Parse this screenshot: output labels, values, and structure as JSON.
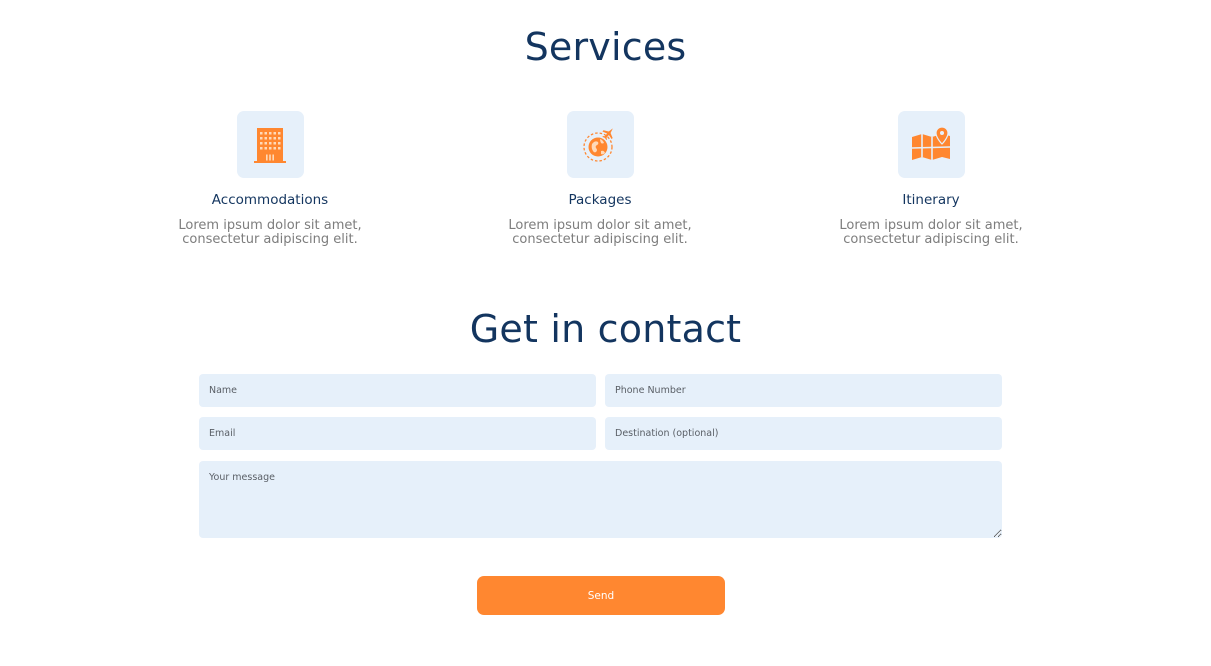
{
  "services": {
    "title": "Services",
    "items": [
      {
        "icon": "hotel-building-icon",
        "title": "Accommodations",
        "desc_line1": "Lorem ipsum dolor sit amet,",
        "desc_line2": "consectetur adipiscing elit."
      },
      {
        "icon": "globe-airplane-icon",
        "title": "Packages",
        "desc_line1": "Lorem ipsum dolor sit amet,",
        "desc_line2": "consectetur adipiscing elit."
      },
      {
        "icon": "map-pin-icon",
        "title": "Itinerary",
        "desc_line1": "Lorem ipsum dolor sit amet,",
        "desc_line2": "consectetur adipiscing elit."
      }
    ]
  },
  "contact": {
    "title": "Get in contact",
    "name_placeholder": "Name",
    "phone_placeholder": "Phone Number",
    "email_placeholder": "Email",
    "destination_placeholder": "Destination (optional)",
    "message_placeholder": "Your message",
    "send_label": "Send"
  },
  "colors": {
    "heading": "#13355f",
    "accent": "#ff8730",
    "field_bg": "#e6f0fa",
    "muted_text": "#7d7d7d"
  }
}
